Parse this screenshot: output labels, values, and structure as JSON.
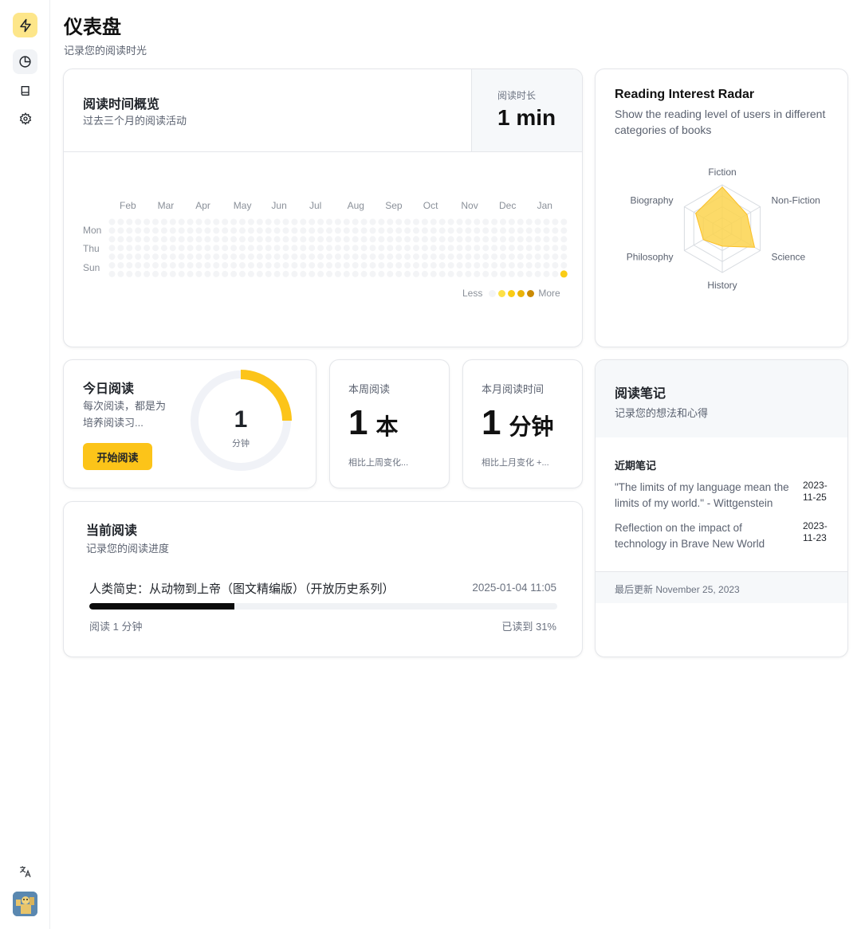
{
  "header": {
    "title": "仪表盘",
    "subtitle": "记录您的阅读时光"
  },
  "sidebar": {
    "icons": [
      "bolt-icon",
      "pie-chart-icon",
      "book-icon",
      "gear-icon",
      "translate-icon",
      "avatar"
    ],
    "active": "pie-chart-icon"
  },
  "heatmap": {
    "title": "阅读时间概览",
    "subtitle": "过去三个月的阅读活动",
    "stat_label": "阅读时长",
    "stat_value": "1 min",
    "months": [
      "Feb",
      "Mar",
      "Apr",
      "May",
      "Jun",
      "Jul",
      "Aug",
      "Sep",
      "Oct",
      "Nov",
      "Dec",
      "Jan"
    ],
    "days": [
      "Mon",
      "Thu",
      "Sun"
    ],
    "weeks": 53,
    "active_cells": [
      {
        "week": 52,
        "day": 6,
        "level": 2
      }
    ],
    "legend_less": "Less",
    "legend_more": "More",
    "levels": [
      "#f3f4f6",
      "#fde047",
      "#facc15",
      "#eab308",
      "#ca8a04"
    ]
  },
  "radar": {
    "title": "Reading Interest Radar",
    "subtitle": "Show the reading level of users in different categories of books",
    "chart_data": {
      "type": "radar",
      "categories": [
        "Fiction",
        "Non-Fiction",
        "Science",
        "History",
        "Philosophy",
        "Biography"
      ],
      "values": [
        0.95,
        0.65,
        0.85,
        0.4,
        0.5,
        0.7
      ],
      "fill_color": "#fcd34d"
    }
  },
  "today": {
    "title": "今日阅读",
    "description": "每次阅读，都是为培养阅读习...",
    "button": "开始阅读",
    "value": "1",
    "unit": "分钟",
    "progress": 0.25
  },
  "week": {
    "label": "本周阅读",
    "value": "1",
    "unit": "本",
    "change": "相比上周变化..."
  },
  "month": {
    "label": "本月阅读时间",
    "value": "1",
    "unit": "分钟",
    "change": "相比上月变化 +..."
  },
  "notes": {
    "title": "阅读笔记",
    "subtitle": "记录您的想法和心得",
    "recent_label": "近期笔记",
    "items": [
      {
        "text": "\"The limits of my language mean the limits of my world.\" - Wittgenstein",
        "date": "2023-11-25"
      },
      {
        "text": "Reflection on the impact of technology in Brave New World",
        "date": "2023-11-23"
      }
    ],
    "footer": "最后更新 November 25, 2023"
  },
  "current": {
    "title": "当前阅读",
    "subtitle": "记录您的阅读进度",
    "book": "人类简史：从动物到上帝（图文精编版）（开放历史系列）",
    "time": "2025-01-04 11:05",
    "read_time": "阅读 1 分钟",
    "percent_text": "已读到 31%",
    "progress": 0.31
  }
}
